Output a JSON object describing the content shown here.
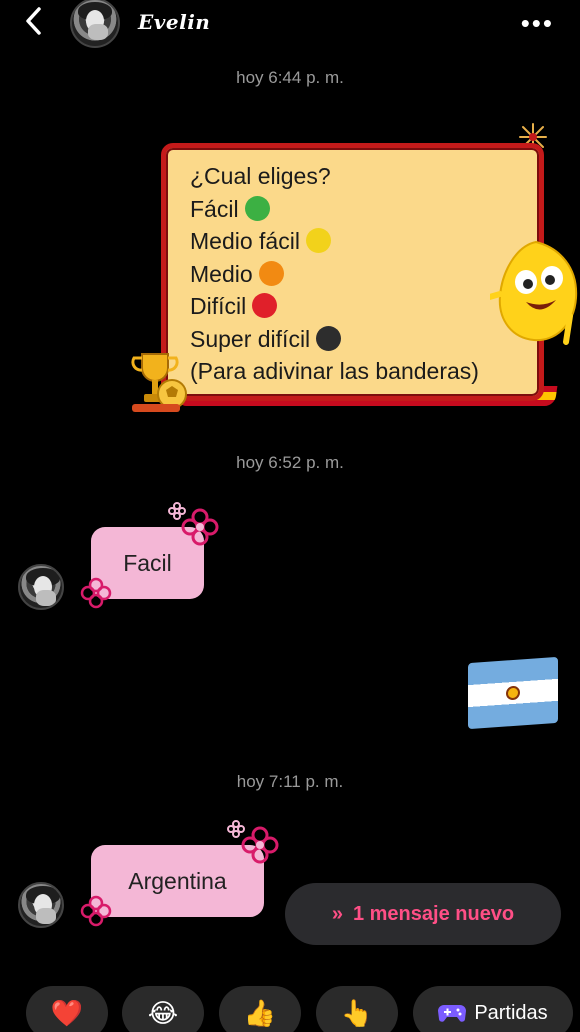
{
  "header": {
    "contact_name": "Evelin"
  },
  "header_more": "•••",
  "timestamps": [
    "hoy 6:44 p. m.",
    "hoy 6:52 p. m.",
    "hoy 7:11 p. m."
  ],
  "card": {
    "lines": [
      {
        "text": "¿Cual eliges?",
        "dot": ""
      },
      {
        "text": "Fácil",
        "dot": "#3cb043"
      },
      {
        "text": "Medio fácil",
        "dot": "#f2d21b"
      },
      {
        "text": "Medio",
        "dot": "#f28a12"
      },
      {
        "text": "Difícil",
        "dot": "#e0202a"
      },
      {
        "text": "Super difícil",
        "dot": "#2d2d2d"
      },
      {
        "text": "(Para adivinar las banderas)",
        "dot": ""
      }
    ]
  },
  "messages": {
    "reply1": "Facil",
    "reply2": "Argentina"
  },
  "sent_sticker": "argentina-flag",
  "new_message_button": "1 mensaje nuevo",
  "quick_actions": [
    {
      "icon": "heart-icon",
      "glyph": "❤️"
    },
    {
      "icon": "laughing-emoji-icon",
      "glyph": "😂"
    },
    {
      "icon": "thumbs-up-icon",
      "glyph": "👍"
    },
    {
      "icon": "pointing-hand-icon",
      "glyph": "👆"
    }
  ],
  "games_button": {
    "label": "Partidas",
    "icon": "gamepad-icon"
  },
  "colors": {
    "card_bg": "#fbd98a",
    "card_border": "#c41a1a",
    "bubble_in": "#f4b7d6",
    "accent_pink": "#ff4f86",
    "timestamp_gray": "#9a9a9a"
  }
}
